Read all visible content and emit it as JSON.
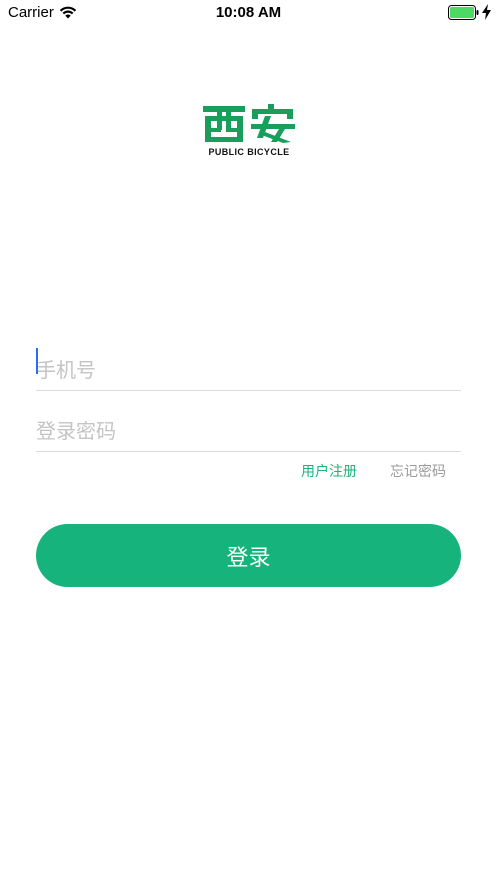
{
  "status_bar": {
    "carrier": "Carrier",
    "time": "10:08 AM",
    "battery_color": "#4cd964"
  },
  "logo": {
    "mark_text": "西安",
    "subtitle": "PUBLIC BICYCLE",
    "brand_color": "#1a9e5c"
  },
  "form": {
    "phone_placeholder": "手机号",
    "password_placeholder": "登录密码",
    "register_label": "用户注册",
    "forgot_label": "忘记密码",
    "login_label": "登录"
  },
  "colors": {
    "accent": "#16b37c",
    "link_green": "#1db27c",
    "muted_link": "#9a9a9a",
    "caret": "#2f6cf6"
  }
}
